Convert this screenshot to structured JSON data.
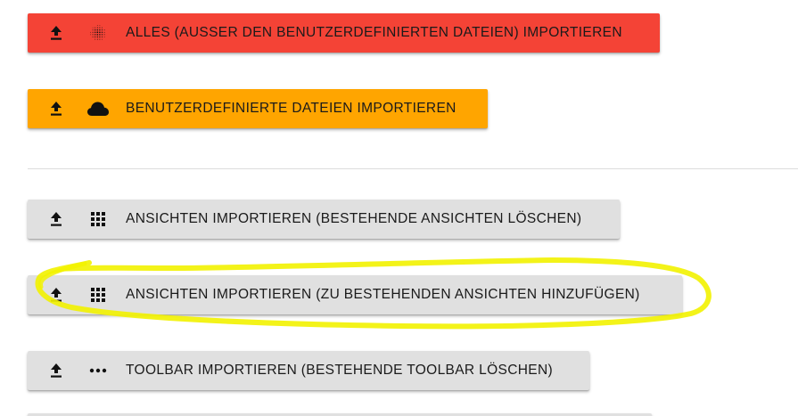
{
  "buttons": {
    "import_all": {
      "label": "ALLES (AUSSER DEN BENUTZERDEFINIERTEN DATEIEN) IMPORTIEREN",
      "icon": "upload-icon",
      "icon2": "dotted-sphere-icon",
      "color": "#f44336"
    },
    "import_custom_files": {
      "label": "BENUTZERDEFINIERTE DATEIEN IMPORTIEREN",
      "icon": "upload-icon",
      "icon2": "cloud-icon",
      "color": "#ffa500"
    },
    "import_views_replace": {
      "label": "ANSICHTEN IMPORTIEREN (BESTEHENDE ANSICHTEN LÖSCHEN)",
      "icon": "upload-icon",
      "icon2": "grid-icon",
      "color": "#e0e0e0"
    },
    "import_views_add": {
      "label": "ANSICHTEN IMPORTIEREN (ZU BESTEHENDEN ANSICHTEN HINZUFÜGEN)",
      "icon": "upload-icon",
      "icon2": "grid-icon",
      "color": "#e0e0e0"
    },
    "import_toolbar_replace": {
      "label": "TOOLBAR IMPORTIEREN (BESTEHENDE TOOLBAR LÖSCHEN)",
      "icon": "upload-icon",
      "icon2": "more-horizontal-icon",
      "color": "#e0e0e0"
    }
  },
  "highlight": {
    "color": "#f2f200"
  }
}
